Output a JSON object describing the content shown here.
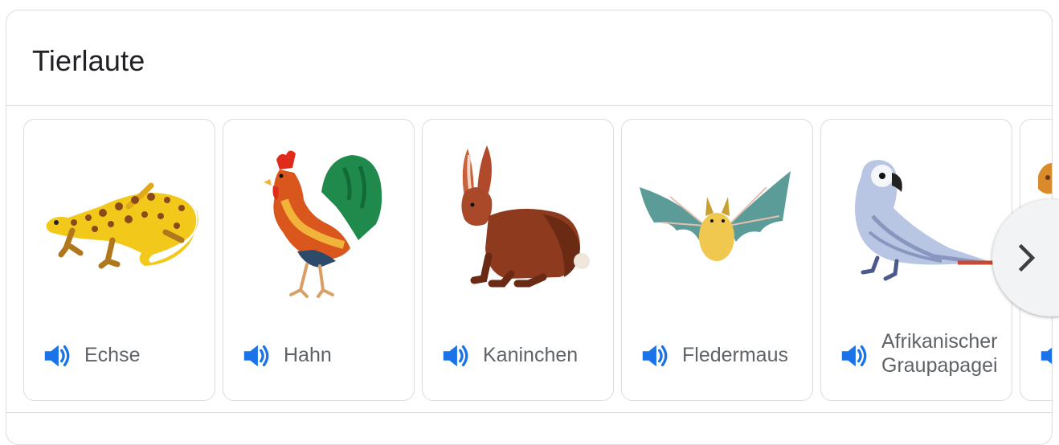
{
  "header": {
    "title": "Tierlaute"
  },
  "cards": [
    {
      "name": "Echse",
      "icon": "lizard-image"
    },
    {
      "name": "Hahn",
      "icon": "rooster-image"
    },
    {
      "name": "Kaninchen",
      "icon": "rabbit-image"
    },
    {
      "name": "Fledermaus",
      "icon": "bat-image"
    },
    {
      "name": "Afrikanischer Graupapagei",
      "line1": "Afrikanischer",
      "line2": "Graupapagei",
      "icon": "parrot-image"
    }
  ],
  "controls": {
    "speaker_icon": "speaker-icon",
    "next_icon": "chevron-right-icon"
  },
  "colors": {
    "speaker": "#1a73e8",
    "border": "#dadce0",
    "label": "#5f6368",
    "title": "#202124"
  }
}
